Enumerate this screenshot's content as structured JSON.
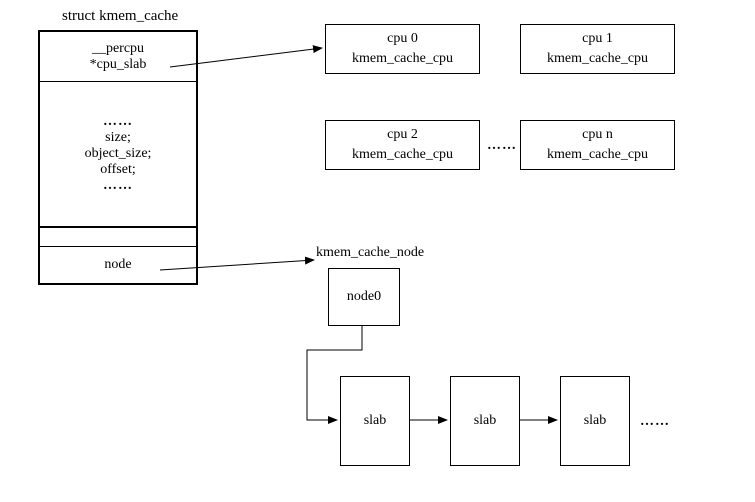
{
  "struct_title": "struct kmem_cache",
  "struct_cells": {
    "percpu_line1": "__percpu",
    "percpu_line2": "*cpu_slab",
    "mid_dots_top": "……",
    "mid_size": "size;",
    "mid_objsize": "object_size;",
    "mid_offset": "offset;",
    "mid_dots_bottom": "……",
    "node": "node"
  },
  "cpu_boxes": [
    {
      "line1": "cpu 0",
      "line2": "kmem_cache_cpu"
    },
    {
      "line1": "cpu 1",
      "line2": "kmem_cache_cpu"
    },
    {
      "line1": "cpu 2",
      "line2": "kmem_cache_cpu"
    },
    {
      "line1": "cpu n",
      "line2": "kmem_cache_cpu"
    }
  ],
  "cpu_dots": "……",
  "node_section": {
    "title": "kmem_cache_node",
    "node_label": "node0"
  },
  "slabs": [
    "slab",
    "slab",
    "slab"
  ],
  "slab_trailing_dots": "……"
}
